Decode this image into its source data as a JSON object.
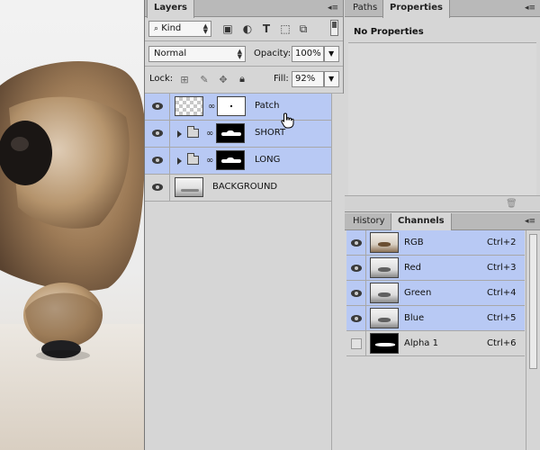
{
  "layers_panel": {
    "tab": "Layers",
    "filter": {
      "kind_label": "Kind"
    },
    "blend_mode": "Normal",
    "opacity_label": "Opacity:",
    "opacity_value": "100%",
    "lock_label": "Lock:",
    "fill_label": "Fill:",
    "fill_value": "92%",
    "layers": [
      {
        "name": "Patch",
        "selected": true,
        "type": "layer"
      },
      {
        "name": "SHORT",
        "selected": true,
        "type": "group"
      },
      {
        "name": "LONG",
        "selected": true,
        "type": "group"
      },
      {
        "name": "BACKGROUND",
        "selected": false,
        "type": "background"
      }
    ]
  },
  "properties_panel": {
    "tabs": [
      "Paths",
      "Properties"
    ],
    "active_tab": "Properties",
    "message": "No Properties"
  },
  "channels_panel": {
    "tabs": [
      "History",
      "Channels"
    ],
    "active_tab": "Channels",
    "channels": [
      {
        "name": "RGB",
        "shortcut": "Ctrl+2",
        "selected": true,
        "visible": true
      },
      {
        "name": "Red",
        "shortcut": "Ctrl+3",
        "selected": true,
        "visible": true
      },
      {
        "name": "Green",
        "shortcut": "Ctrl+4",
        "selected": true,
        "visible": true
      },
      {
        "name": "Blue",
        "shortcut": "Ctrl+5",
        "selected": true,
        "visible": true
      },
      {
        "name": "Alpha 1",
        "shortcut": "Ctrl+6",
        "selected": false,
        "visible": false
      }
    ]
  },
  "colors": {
    "selection": "#b8c9f4",
    "panel_bg": "#d6d6d6",
    "tab_bar": "#b9b9b9"
  }
}
